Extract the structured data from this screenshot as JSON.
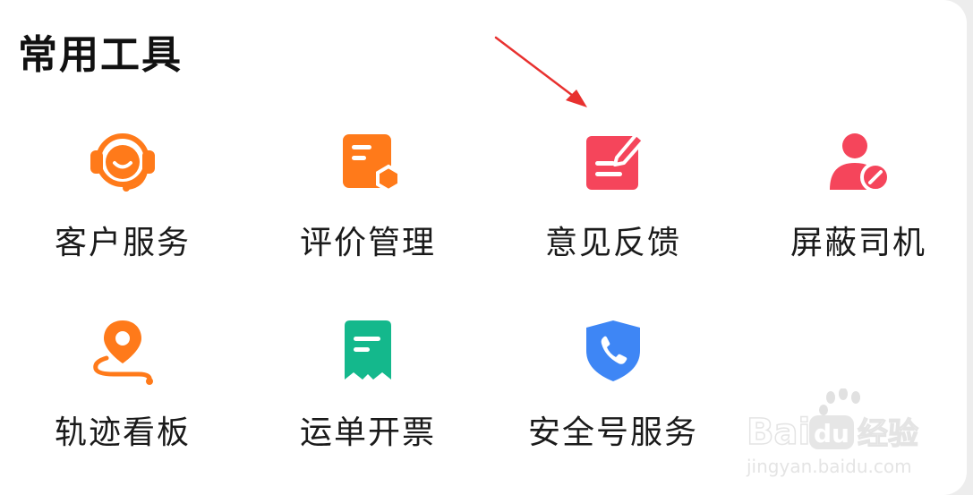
{
  "section": {
    "title": "常用工具"
  },
  "tools": [
    {
      "label": "客户服务",
      "icon": "headset-icon",
      "color": "#FF7A1A"
    },
    {
      "label": "评价管理",
      "icon": "review-icon",
      "color": "#FF7A1A"
    },
    {
      "label": "意见反馈",
      "icon": "feedback-edit-icon",
      "color": "#F5455B"
    },
    {
      "label": "屏蔽司机",
      "icon": "block-driver-icon",
      "color": "#F5455B"
    },
    {
      "label": "轨迹看板",
      "icon": "route-pin-icon",
      "color": "#FF7A1A"
    },
    {
      "label": "运单开票",
      "icon": "invoice-icon",
      "color": "#14B88C"
    },
    {
      "label": "安全号服务",
      "icon": "shield-phone-icon",
      "color": "#3E86F5"
    }
  ],
  "annotation": {
    "arrow_color": "#E8312F"
  },
  "watermark": {
    "brand": "Baidu经验",
    "url": "jingyan.baidu.com"
  }
}
